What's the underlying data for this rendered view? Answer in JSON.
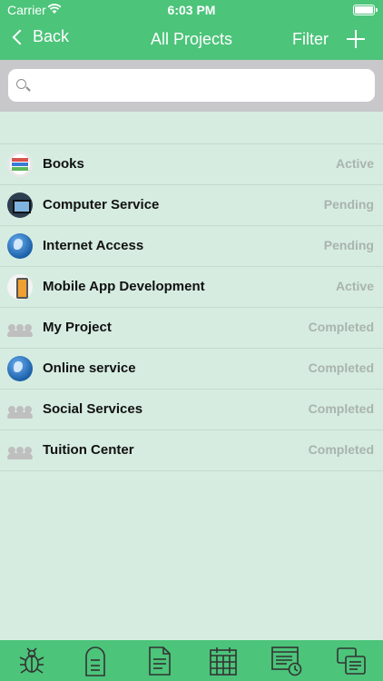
{
  "status_bar": {
    "carrier": "Carrier",
    "time": "6:03 PM"
  },
  "nav": {
    "back_label": "Back",
    "title": "All Projects",
    "filter_label": "Filter"
  },
  "search": {
    "placeholder": "",
    "value": ""
  },
  "projects": [
    {
      "name": "Books",
      "status": "Active",
      "icon": "books-icon"
    },
    {
      "name": "Computer Service",
      "status": "Pending",
      "icon": "computer-icon"
    },
    {
      "name": "Internet Access",
      "status": "Pending",
      "icon": "globe-icon"
    },
    {
      "name": "Mobile App Development",
      "status": "Active",
      "icon": "mobile-app-icon"
    },
    {
      "name": "My Project",
      "status": "Completed",
      "icon": "people-icon"
    },
    {
      "name": "Online service",
      "status": "Completed",
      "icon": "globe-icon"
    },
    {
      "name": "Social Services",
      "status": "Completed",
      "icon": "people-icon"
    },
    {
      "name": "Tuition Center",
      "status": "Completed",
      "icon": "people-icon"
    }
  ],
  "tabbar": {
    "items": [
      "bug-icon",
      "mailbox-icon",
      "document-icon",
      "calendar-icon",
      "report-clock-icon",
      "copy-pages-icon"
    ]
  },
  "colors": {
    "header_green": "#4cc47a",
    "list_background": "#d6ece1",
    "status_gray": "#a9b4ad"
  }
}
